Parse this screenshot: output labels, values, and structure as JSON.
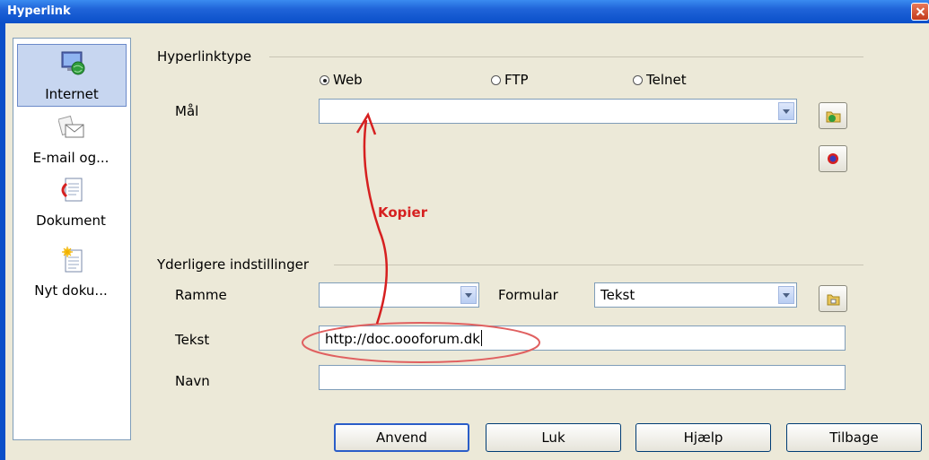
{
  "window": {
    "title": "Hyperlink"
  },
  "sidebar": {
    "items": [
      {
        "label": "Internet",
        "icon": "globe-computer-icon",
        "selected": true
      },
      {
        "label": "E-mail og...",
        "icon": "envelope-icon",
        "selected": false
      },
      {
        "label": "Dokument",
        "icon": "document-icon",
        "selected": false
      },
      {
        "label": "Nyt doku...",
        "icon": "new-document-icon",
        "selected": false
      }
    ]
  },
  "hyperlink_type": {
    "title": "Hyperlinktype",
    "options": [
      {
        "label": "Web",
        "mnemonic": "W",
        "selected": true
      },
      {
        "label": "FTP",
        "mnemonic": "F",
        "selected": false
      },
      {
        "label": "Telnet",
        "mnemonic": "T",
        "selected": false
      }
    ],
    "target": {
      "label": "Mål",
      "value": ""
    }
  },
  "more_settings": {
    "title": "Yderligere indstillinger",
    "frame": {
      "label": "Ramme",
      "value": ""
    },
    "form": {
      "label": "Formular",
      "value": "Tekst"
    },
    "text": {
      "label": "Tekst",
      "value": "http://doc.oooforum.dk"
    },
    "name": {
      "label": "Navn",
      "value": ""
    }
  },
  "annotation": {
    "label": "Kopier",
    "color": "#d62020"
  },
  "buttons": {
    "apply": "Anvend",
    "close": "Luk",
    "help": "Hjælp",
    "back": "Tilbage"
  },
  "colors": {
    "titlebar": "#0a4fc9",
    "dialog_bg": "#ece9d8",
    "selection": "#c7d6f0"
  }
}
